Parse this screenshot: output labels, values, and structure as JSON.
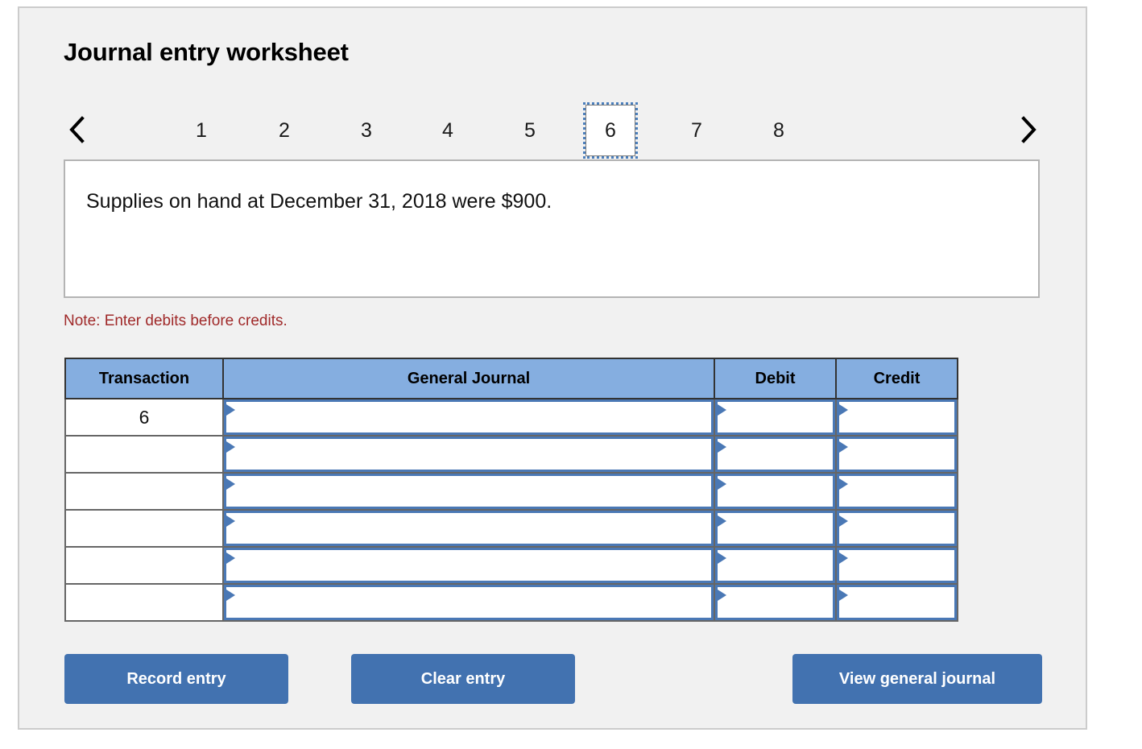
{
  "worksheet": {
    "title": "Journal entry worksheet",
    "statement": "Supplies on hand at December 31, 2018 were $900.",
    "note": "Note: Enter debits before credits."
  },
  "tabs": {
    "prev_icon": "chevron-left-icon",
    "next_icon": "chevron-right-icon",
    "items": [
      {
        "label": "1",
        "active": false
      },
      {
        "label": "2",
        "active": false
      },
      {
        "label": "3",
        "active": false
      },
      {
        "label": "4",
        "active": false
      },
      {
        "label": "5",
        "active": false
      },
      {
        "label": "6",
        "active": true
      },
      {
        "label": "7",
        "active": false
      },
      {
        "label": "8",
        "active": false
      }
    ],
    "active_label": "6"
  },
  "table": {
    "headers": {
      "transaction": "Transaction",
      "general_journal": "General Journal",
      "debit": "Debit",
      "credit": "Credit"
    },
    "rows": [
      {
        "transaction": "6",
        "general_journal": "",
        "debit": "",
        "credit": ""
      },
      {
        "transaction": "",
        "general_journal": "",
        "debit": "",
        "credit": ""
      },
      {
        "transaction": "",
        "general_journal": "",
        "debit": "",
        "credit": ""
      },
      {
        "transaction": "",
        "general_journal": "",
        "debit": "",
        "credit": ""
      },
      {
        "transaction": "",
        "general_journal": "",
        "debit": "",
        "credit": ""
      },
      {
        "transaction": "",
        "general_journal": "",
        "debit": "",
        "credit": ""
      }
    ]
  },
  "actions": {
    "record_entry": "Record entry",
    "clear_entry": "Clear entry",
    "view_general_journal": "View general journal"
  },
  "colors": {
    "panel_bg": "#f1f1f1",
    "header_blue": "#85aee0",
    "button_blue": "#4272b0",
    "field_border_blue": "#4a78b5",
    "note_red": "#a02a2a",
    "focus_blue": "#4a7ebb"
  }
}
